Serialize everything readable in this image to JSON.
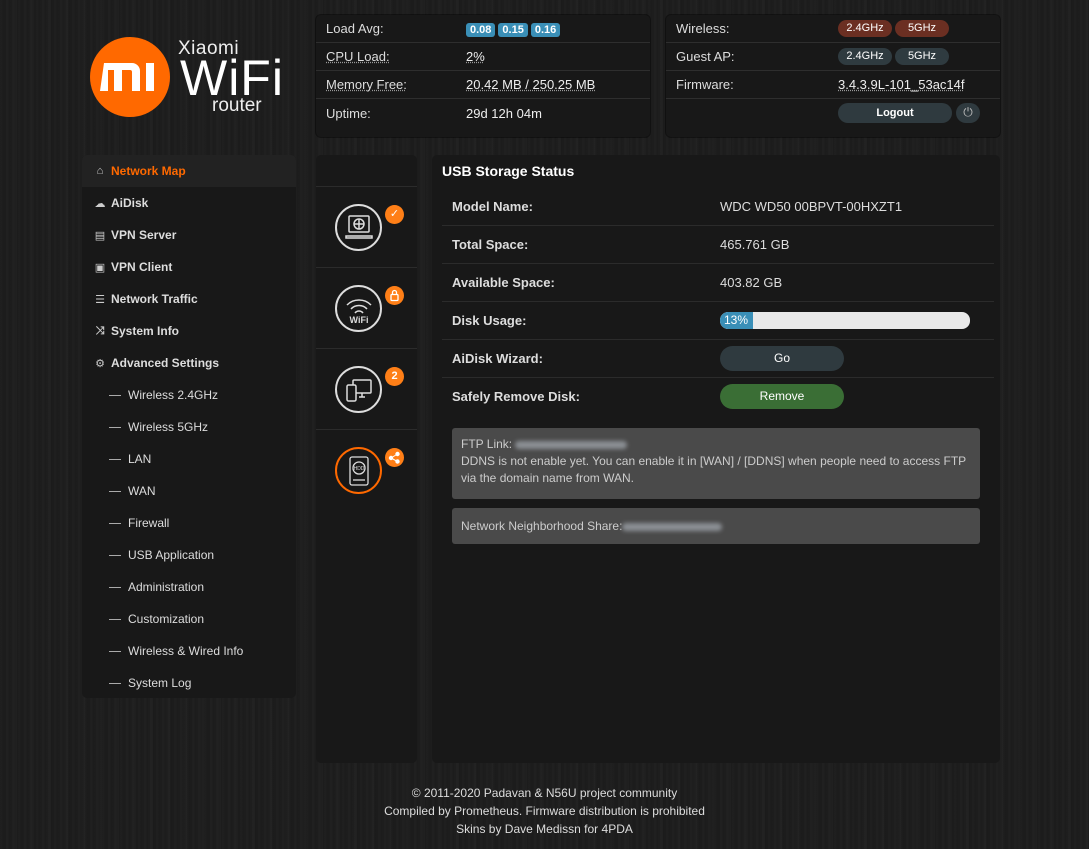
{
  "logo": {
    "brand_mark": "MI",
    "line1": "Xiaomi",
    "line2": "WiFi",
    "line3": "router",
    "accent": "#ff6900"
  },
  "status_left": {
    "load_label": "Load Avg:",
    "load_values": [
      "0.08",
      "0.15",
      "0.16"
    ],
    "cpu_label": "CPU Load:",
    "cpu_value": "2%",
    "mem_label": "Memory Free:",
    "mem_value": "20.42 MB / 250.25 MB",
    "uptime_label": "Uptime:",
    "uptime_value": "29d 12h 04m"
  },
  "status_right": {
    "wireless_label": "Wireless:",
    "wireless_24": "2.4GHz",
    "wireless_5": "5GHz",
    "guest_label": "Guest AP:",
    "guest_24": "2.4GHz",
    "guest_5": "5GHz",
    "firmware_label": "Firmware:",
    "firmware_value": "3.4.3.9L-101_53ac14f",
    "logout_label": "Logout",
    "power_icon": "power-icon"
  },
  "sidebar": {
    "items": [
      {
        "label": "Network Map",
        "icon": "home-icon"
      },
      {
        "label": "AiDisk",
        "icon": "cloud-icon"
      },
      {
        "label": "VPN Server",
        "icon": "vpn-server-icon"
      },
      {
        "label": "VPN Client",
        "icon": "vpn-client-icon"
      },
      {
        "label": "Network Traffic",
        "icon": "traffic-icon"
      },
      {
        "label": "System Info",
        "icon": "shuffle-icon"
      },
      {
        "label": "Advanced Settings",
        "icon": "gear-icon"
      }
    ],
    "sub_items": [
      "Wireless 2.4GHz",
      "Wireless 5GHz",
      "LAN",
      "WAN",
      "Firewall",
      "USB Application",
      "Administration",
      "Customization",
      "Wireless & Wired Info",
      "System Log"
    ]
  },
  "icons": {
    "internet_badge": "✓",
    "wifi_badge": "🔒",
    "clients_badge": "2",
    "usb_badge": "share",
    "wifi_text": "WiFi",
    "hdd_text": "HDD"
  },
  "main": {
    "title": "USB Storage Status",
    "model_label": "Model Name:",
    "model_value": "WDC WD50 00BPVT-00HXZT1",
    "total_label": "Total Space:",
    "total_value": "465.761 GB",
    "avail_label": "Available Space:",
    "avail_value": "403.82 GB",
    "usage_label": "Disk Usage:",
    "usage_text": "13%",
    "usage_fraction": 0.13,
    "wizard_label": "AiDisk Wizard:",
    "wizard_button": "Go",
    "remove_label": "Safely Remove Disk:",
    "remove_button": "Remove",
    "ftp_label": "FTP Link:",
    "ftp_note": "DDNS is not enable yet. You can enable it in [WAN] / [DDNS] when people need to access FTP via the domain name from WAN.",
    "share_label": "Network Neighborhood Share:"
  },
  "footer": {
    "line1": "© 2011-2020 Padavan & N56U project community",
    "line2": "Compiled by Prometheus. Firmware distribution is prohibited",
    "line3": "Skins by Dave Medissn for 4PDA"
  }
}
